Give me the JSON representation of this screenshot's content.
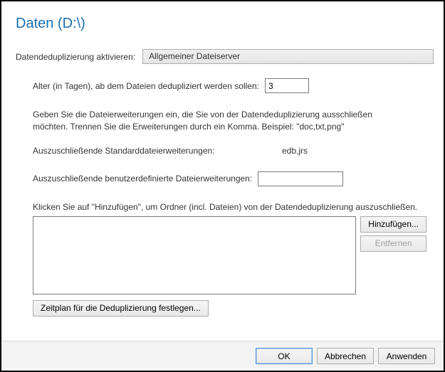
{
  "title": "Daten (D:\\)",
  "activate": {
    "label": "Datendeduplizierung aktivieren:",
    "value": "Allgemeiner Dateiserver"
  },
  "age": {
    "label": "Alter (in Tagen), ab dem Dateien dedupliziert werden sollen:",
    "value": "3"
  },
  "extensionsHelp": "Geben Sie die Dateierweiterungen ein, die Sie von der Datendeduplizierung ausschließen möchten. Trennen Sie die Erweiterungen durch ein Komma. Beispiel: \"doc,txt,png\"",
  "stdExt": {
    "label": "Auszuschließende Standarddateierweiterungen:",
    "value": "edb,jrs"
  },
  "userExt": {
    "label": "Auszuschließende benutzerdefinierte Dateierweiterungen:",
    "value": ""
  },
  "excludeHelp": "Klicken Sie auf \"Hinzufügen\", um Ordner (incl. Dateien) von der Datendeduplizierung auszuschließen.",
  "buttons": {
    "add": "Hinzufügen...",
    "remove": "Entfernen",
    "schedule": "Zeitplan für die Deduplizierung festlegen...",
    "ok": "OK",
    "cancel": "Abbrechen",
    "apply": "Anwenden"
  }
}
